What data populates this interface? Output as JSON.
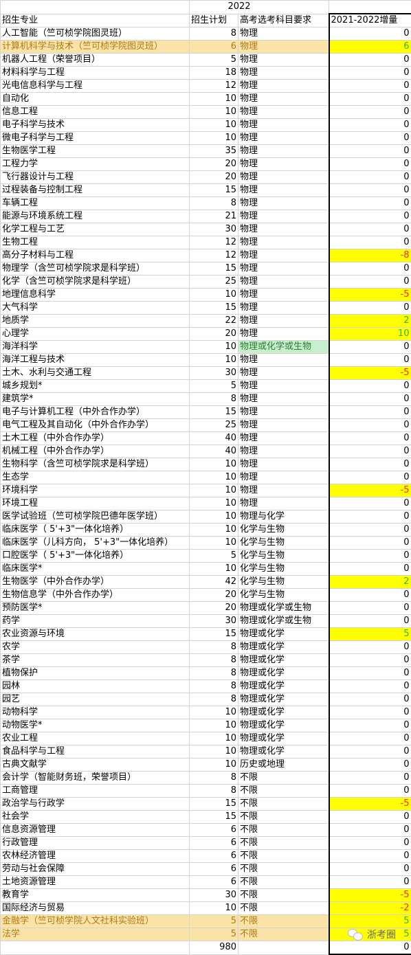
{
  "title": "2022",
  "headers": {
    "major": "招生专业",
    "plan": "招生计划",
    "req": "高考选考科目要求",
    "inc": "2021-2022增量"
  },
  "rows": [
    {
      "major": "人工智能（竺可桢学院图灵班）",
      "plan": "8",
      "req": "物理",
      "inc": "0"
    },
    {
      "major": "计算机科学与技术（竺可桢学院图灵班）",
      "plan": "6",
      "req": "物理",
      "inc": "6",
      "hl": true
    },
    {
      "major": "机器人工程（荣誉项目）",
      "plan": "5",
      "req": "物理",
      "inc": "0"
    },
    {
      "major": "材料科学与工程",
      "plan": "18",
      "req": "物理",
      "inc": "0"
    },
    {
      "major": "光电信息科学与工程",
      "plan": "12",
      "req": "物理",
      "inc": "0"
    },
    {
      "major": "自动化",
      "plan": "10",
      "req": "物理",
      "inc": "0"
    },
    {
      "major": "信息工程",
      "plan": "10",
      "req": "物理",
      "inc": "0"
    },
    {
      "major": "电子科学与技术",
      "plan": "10",
      "req": "物理",
      "inc": "0"
    },
    {
      "major": "微电子科学与工程",
      "plan": "10",
      "req": "物理",
      "inc": "0"
    },
    {
      "major": "生物医学工程",
      "plan": "35",
      "req": "物理",
      "inc": "0"
    },
    {
      "major": "工程力学",
      "plan": "20",
      "req": "物理",
      "inc": "0"
    },
    {
      "major": "飞行器设计与工程",
      "plan": "20",
      "req": "物理",
      "inc": "0"
    },
    {
      "major": "过程装备与控制工程",
      "plan": "15",
      "req": "物理",
      "inc": "0"
    },
    {
      "major": "车辆工程",
      "plan": "8",
      "req": "物理",
      "inc": "0"
    },
    {
      "major": "能源与环境系统工程",
      "plan": "21",
      "req": "物理",
      "inc": "0"
    },
    {
      "major": "化学工程与工艺",
      "plan": "30",
      "req": "物理",
      "inc": "0"
    },
    {
      "major": "生物工程",
      "plan": "12",
      "req": "物理",
      "inc": "0"
    },
    {
      "major": "高分子材料与工程",
      "plan": "12",
      "req": "物理",
      "inc": "-8"
    },
    {
      "major": "物理学（含竺可桢学院求是科学班）",
      "plan": "15",
      "req": "物理",
      "inc": "0"
    },
    {
      "major": "化学（含竺可桢学院求是科学班）",
      "plan": "25",
      "req": "物理",
      "inc": "0"
    },
    {
      "major": "地理信息科学",
      "plan": "10",
      "req": "物理",
      "inc": "-5"
    },
    {
      "major": "大气科学",
      "plan": "15",
      "req": "物理",
      "inc": "0"
    },
    {
      "major": "地质学",
      "plan": "22",
      "req": "物理",
      "inc": "2"
    },
    {
      "major": "心理学",
      "plan": "20",
      "req": "物理",
      "inc": "10"
    },
    {
      "major": "海洋科学",
      "plan": "10",
      "req": "物理或化学或生物",
      "inc": "0",
      "greenReq": true
    },
    {
      "major": "海洋工程与技术",
      "plan": "10",
      "req": "物理",
      "inc": "0"
    },
    {
      "major": "土木、水利与交通工程",
      "plan": "30",
      "req": "物理",
      "inc": "-5"
    },
    {
      "major": "城乡规划*",
      "plan": "5",
      "req": "物理",
      "inc": "0"
    },
    {
      "major": "建筑学*",
      "plan": "8",
      "req": "物理",
      "inc": "0"
    },
    {
      "major": "电子与计算机工程（中外合作办学）",
      "plan": "15",
      "req": "物理",
      "inc": "0"
    },
    {
      "major": "电气工程及其自动化（中外合作办学）",
      "plan": "25",
      "req": "物理",
      "inc": "0"
    },
    {
      "major": "土木工程（中外合作办学）",
      "plan": "40",
      "req": "物理",
      "inc": "0"
    },
    {
      "major": "机械工程（中外合作办学）",
      "plan": "40",
      "req": "物理",
      "inc": "0"
    },
    {
      "major": "生物科学（含竺可桢学院求是科学班）",
      "plan": "10",
      "req": "物理",
      "inc": "0"
    },
    {
      "major": "生态学",
      "plan": "10",
      "req": "物理",
      "inc": "0"
    },
    {
      "major": "环境科学",
      "plan": "10",
      "req": "物理",
      "inc": "-5"
    },
    {
      "major": "环境工程",
      "plan": "10",
      "req": "物理",
      "inc": "0"
    },
    {
      "major": "医学试验班（竺可桢学院巴德年医学班）",
      "plan": "10",
      "req": "物理与化学",
      "inc": "0"
    },
    {
      "major": "临床医学（ 5'+3\"一体化培养）",
      "plan": "10",
      "req": "化学与生物",
      "inc": "0"
    },
    {
      "major": "临床医学（儿科方向， 5'+3\"一体化培养）",
      "plan": "10",
      "req": "化学与生物",
      "inc": "0"
    },
    {
      "major": "口腔医学（ 5'+3\"一体化培养）",
      "plan": "5",
      "req": "化学与生物",
      "inc": "0"
    },
    {
      "major": "临床医学*",
      "plan": "10",
      "req": "化学与生物",
      "inc": "0"
    },
    {
      "major": "生物医学（中外合作办学）",
      "plan": "42",
      "req": "化学与生物",
      "inc": "2"
    },
    {
      "major": "生物信息学（中外合作办学）",
      "plan": "20",
      "req": "化学与生物",
      "inc": "0"
    },
    {
      "major": "预防医学*",
      "plan": "20",
      "req": "物理或化学或生物",
      "inc": "0"
    },
    {
      "major": "药学",
      "plan": "30",
      "req": "物理或化学或生物",
      "inc": "0"
    },
    {
      "major": "农业资源与环境",
      "plan": "15",
      "req": "物理或化学",
      "inc": "5"
    },
    {
      "major": "农学",
      "plan": "8",
      "req": "物理或化学",
      "inc": "0"
    },
    {
      "major": "茶学",
      "plan": "8",
      "req": "物理或化学",
      "inc": "0"
    },
    {
      "major": "植物保护",
      "plan": "8",
      "req": "物理或化学",
      "inc": "0"
    },
    {
      "major": "园林",
      "plan": "8",
      "req": "物理或化学",
      "inc": "0"
    },
    {
      "major": "园艺",
      "plan": "8",
      "req": "物理或化学",
      "inc": "0"
    },
    {
      "major": "动物科学",
      "plan": "10",
      "req": "物理或化学",
      "inc": "0"
    },
    {
      "major": "动物医学*",
      "plan": "10",
      "req": "物理或化学",
      "inc": "0"
    },
    {
      "major": "农业工程",
      "plan": "10",
      "req": "物理或化学",
      "inc": "0"
    },
    {
      "major": "食品科学与工程",
      "plan": "10",
      "req": "物理或化学",
      "inc": "0"
    },
    {
      "major": "古典文献学",
      "plan": "10",
      "req": "历史或地理",
      "inc": "0"
    },
    {
      "major": "会计学（智能财务班，荣誉项目）",
      "plan": "8",
      "req": "不限",
      "inc": "0"
    },
    {
      "major": "工商管理",
      "plan": "8",
      "req": "不限",
      "inc": "0"
    },
    {
      "major": "政治学与行政学",
      "plan": "15",
      "req": "不限",
      "inc": "-5"
    },
    {
      "major": "社会学",
      "plan": "15",
      "req": "不限",
      "inc": "0"
    },
    {
      "major": "信息资源管理",
      "plan": "6",
      "req": "不限",
      "inc": "0"
    },
    {
      "major": "行政管理",
      "plan": "6",
      "req": "不限",
      "inc": "0"
    },
    {
      "major": "农林经济管理",
      "plan": "6",
      "req": "不限",
      "inc": "0"
    },
    {
      "major": "劳动与社会保障",
      "plan": "6",
      "req": "不限",
      "inc": "0"
    },
    {
      "major": "土地资源管理",
      "plan": "6",
      "req": "不限",
      "inc": "0"
    },
    {
      "major": "教育学",
      "plan": "30",
      "req": "不限",
      "inc": "-5"
    },
    {
      "major": "国际经济与贸易",
      "plan": "10",
      "req": "不限",
      "inc": "-2"
    },
    {
      "major": "金融学（竺可桢学院人文社科实验班）",
      "plan": "5",
      "req": "不限",
      "inc": "5",
      "hl": true
    },
    {
      "major": "法学",
      "plan": "5",
      "req": "不限",
      "inc": "5",
      "hl": true
    }
  ],
  "total": {
    "plan": "980",
    "inc": "0"
  },
  "watermark": {
    "text": "浙考圈",
    "icon": "wechat-icon"
  },
  "colors": {
    "highlight_row": "#fbe3a7",
    "yellow": "#ffff00",
    "positive": "#33b233",
    "negative": "#ff2020",
    "green_req": "#c6efce"
  }
}
